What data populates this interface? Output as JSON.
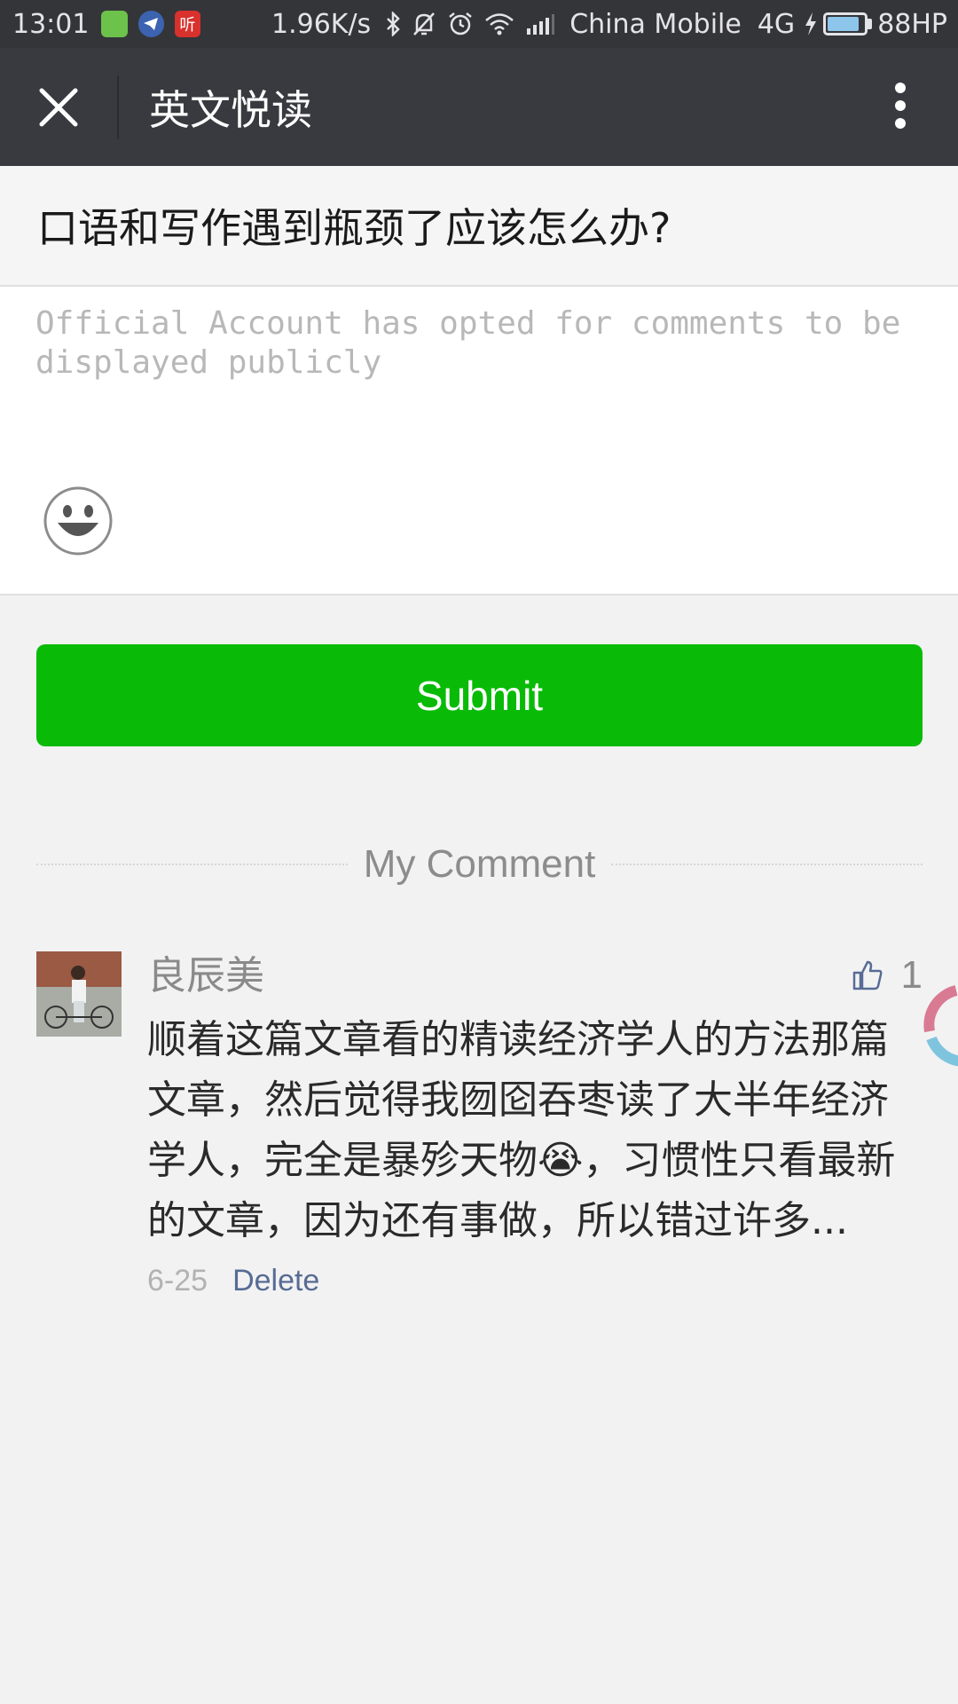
{
  "status_bar": {
    "time": "13:01",
    "app_icon_3_text": "听",
    "speed": "1.96K/s",
    "carrier": "China Mobile",
    "network": "4G",
    "battery": "88HP",
    "battery_level": 0.88
  },
  "nav": {
    "title": "英文悦读"
  },
  "article": {
    "title": "口语和写作遇到瓶颈了应该怎么办?"
  },
  "compose": {
    "placeholder": "Official Account has opted for comments to be displayed publicly",
    "value": ""
  },
  "submit": {
    "label": "Submit"
  },
  "section": {
    "label": "My Comment"
  },
  "comment": {
    "nickname": "良辰美",
    "likes": "1",
    "text": "顺着这篇文章看的精读经济学人的方法那篇文章，然后觉得我囫囵吞枣读了大半年经济学人，完全是暴殄天物😭，习惯性只看最新的文章，因为还有事做，所以错过许多...",
    "date": "6-25",
    "delete_label": "Delete"
  },
  "colors": {
    "accent_green": "#09bb07",
    "nav_bg": "#393a3f",
    "link_blue": "#576b95"
  }
}
